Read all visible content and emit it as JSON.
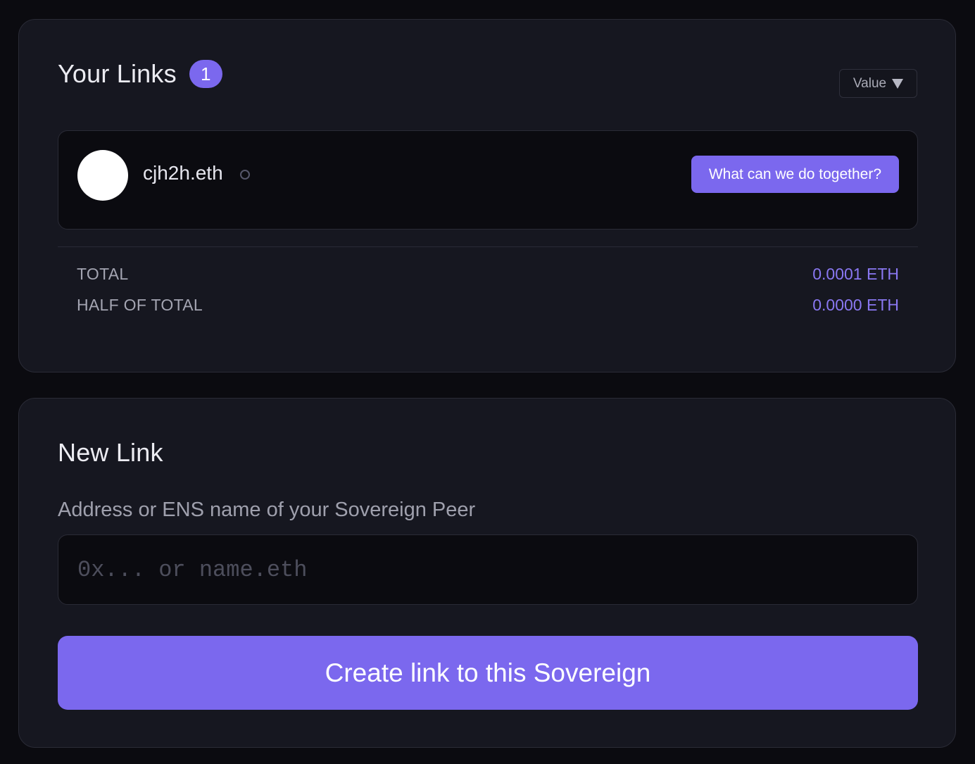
{
  "links_card": {
    "title": "Your Links",
    "count": "1",
    "sort_label": "Value",
    "sort_icon": "caret-down-icon",
    "items": [
      {
        "name": "cjh2h.eth",
        "status_icon": "status-dot-icon",
        "action_label": "What can we do together?"
      }
    ],
    "summary": {
      "total_label": "TOTAL",
      "total_value": "0.0001 ETH",
      "half_label": "HALF OF TOTAL",
      "half_value": "0.0000 ETH"
    }
  },
  "new_link_card": {
    "title": "New Link",
    "field_label": "Address or ENS name of your Sovereign Peer",
    "input_value": "",
    "input_placeholder": "0x... or name.eth",
    "submit_label": "Create link to this Sovereign"
  },
  "colors": {
    "background": "#0b0b10",
    "card": "#161720",
    "accent": "#7b68ee",
    "value_text": "#8a78f2",
    "muted_text": "#a4a5b2"
  }
}
